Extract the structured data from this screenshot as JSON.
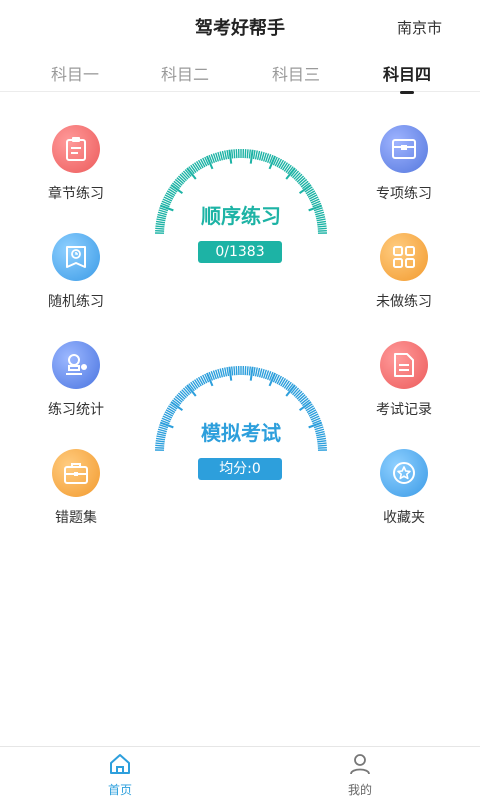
{
  "header": {
    "title": "驾考好帮手",
    "city": "南京市"
  },
  "tabs": [
    {
      "label": "科目一"
    },
    {
      "label": "科目二"
    },
    {
      "label": "科目三"
    },
    {
      "label": "科目四",
      "active": true
    }
  ],
  "features_left": [
    {
      "label": "章节练习",
      "icon": "clipboard-icon",
      "color": "#ef6b6b"
    },
    {
      "label": "随机练习",
      "icon": "clock-book-icon",
      "color": "#4aa7ec"
    },
    {
      "label": "练习统计",
      "icon": "stamp-icon",
      "color": "#4d80e6"
    },
    {
      "label": "错题集",
      "icon": "briefcase-icon",
      "color": "#f3a23d"
    }
  ],
  "features_right": [
    {
      "label": "专项练习",
      "icon": "box-icon",
      "color": "#5b7fe0"
    },
    {
      "label": "未做练习",
      "icon": "grid-icon",
      "color": "#f3a23d"
    },
    {
      "label": "考试记录",
      "icon": "document-icon",
      "color": "#ef6b6b"
    },
    {
      "label": "收藏夹",
      "icon": "star-icon",
      "color": "#4aa7ec"
    }
  ],
  "gauges": {
    "sequential": {
      "title": "顺序练习",
      "badge": "0/1383",
      "color": "#1db3a5"
    },
    "mock": {
      "title": "模拟考试",
      "badge": "均分:0",
      "color": "#2d9fdc"
    }
  },
  "bottom_nav": [
    {
      "label": "首页",
      "icon": "home-icon",
      "active": true
    },
    {
      "label": "我的",
      "icon": "user-icon",
      "active": false
    }
  ],
  "colors": {
    "active_nav": "#2d9fdc",
    "inactive_nav": "#666666"
  }
}
